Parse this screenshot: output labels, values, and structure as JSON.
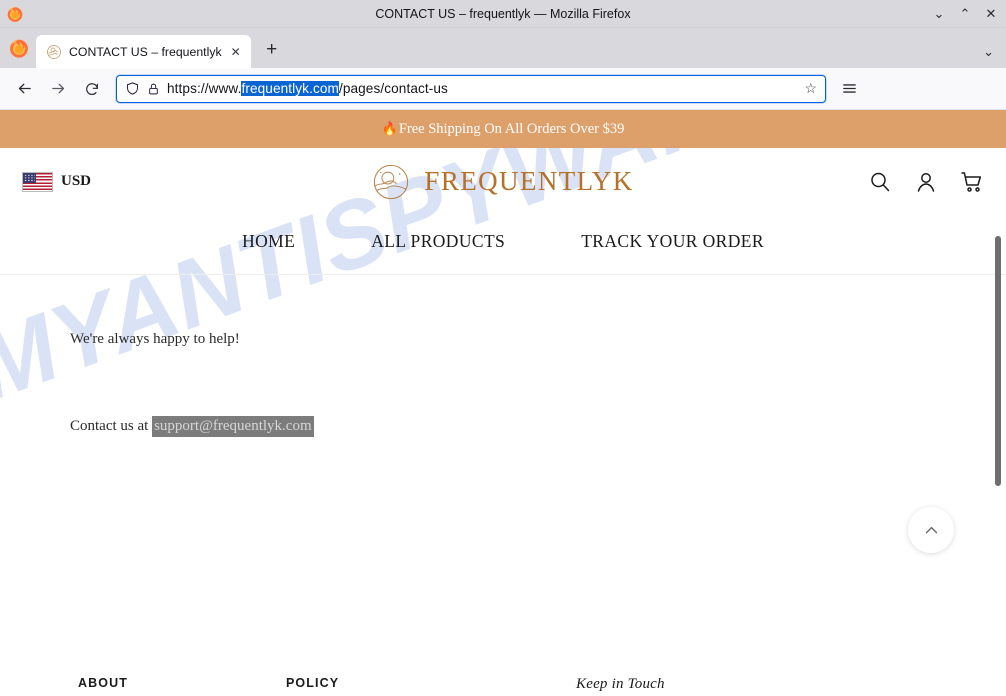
{
  "browser": {
    "window_title": "CONTACT US – frequentlyk — Mozilla Firefox",
    "minimize_label": "⌄",
    "maximize_label": "⌃",
    "close_label": "✕",
    "tab": {
      "title": "CONTACT US – frequentlyk",
      "close_label": "✕"
    },
    "new_tab_label": "+",
    "tab_list_label": "⌄",
    "back_label": "←",
    "forward_label": "→",
    "reload_label": "↻",
    "url": {
      "prefix": "https://www.",
      "selected": "frequentlyk.com",
      "suffix": "/pages/contact-us"
    },
    "bookmark_label": "☆",
    "menu_label": "☰"
  },
  "site": {
    "announcement": {
      "emoji": "🔥",
      "text": "Free Shipping On All Orders Over $39"
    },
    "currency": {
      "flag": "us-flag-icon",
      "label": "USD"
    },
    "logo": {
      "mark": "circle-landscape-emblem-icon",
      "text": "FREQUENTLYK",
      "color": "#b5702a"
    },
    "header_icons": [
      {
        "name": "search-icon"
      },
      {
        "name": "account-icon"
      },
      {
        "name": "cart-icon"
      }
    ],
    "nav": [
      {
        "label": "HOME"
      },
      {
        "label": "ALL PRODUCTS"
      },
      {
        "label": "TRACK YOUR ORDER"
      }
    ],
    "content": {
      "help_text": "We're always happy to help!",
      "contact_prefix": "Contact us at ",
      "contact_email": "support@frequentlyk.com"
    },
    "back_to_top_label": "chevron-up-icon",
    "footer": {
      "columns": [
        {
          "heading": "ABOUT"
        },
        {
          "heading": "POLICY"
        },
        {
          "heading": "Keep in Touch"
        }
      ]
    }
  },
  "overlay": {
    "watermark": "MYANTISPYWARE.COM"
  },
  "colors": {
    "announcement_bg": "#dda06a",
    "brand": "#b5702a",
    "url_selection": "#0a64d2",
    "watermark": "#cdd8f2"
  }
}
